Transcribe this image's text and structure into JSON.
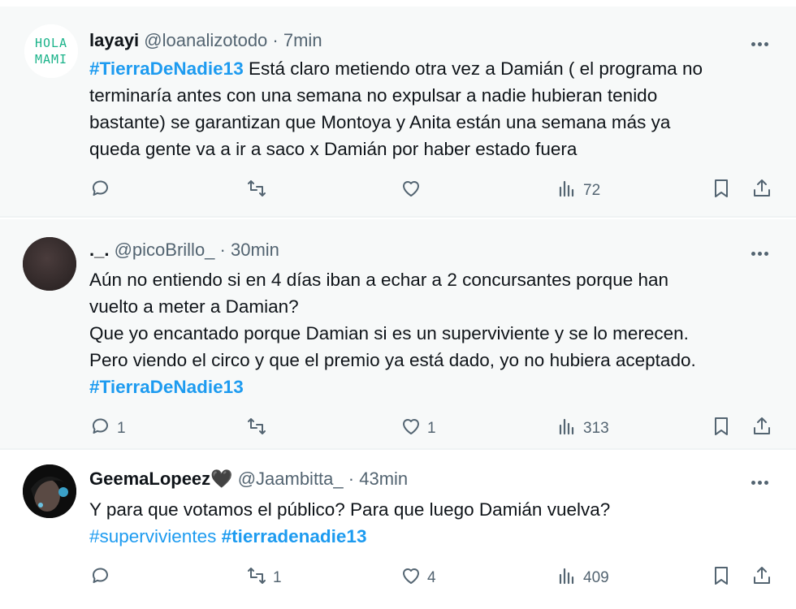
{
  "tweets": [
    {
      "name": "layayi",
      "handle": "@loanalizotodo",
      "separator": "·",
      "time": "7min",
      "avatar_text": "HOLA MAMI",
      "lines": [
        [
          {
            "text": "#TierraDeNadie13",
            "style": "tag-bold"
          },
          {
            "text": " Está claro metiendo otra vez a Damián ( el programa no",
            "style": "text"
          }
        ],
        [
          {
            "text": "terminaría antes con una semana no expulsar a nadie hubieran tenido",
            "style": "text"
          }
        ],
        [
          {
            "text": "bastante) se garantizan que Montoya y Anita están una semana más ya",
            "style": "text"
          }
        ],
        [
          {
            "text": "queda gente va a ir a saco x Damián por haber estado fuera",
            "style": "text"
          }
        ]
      ],
      "counts": {
        "reply": "",
        "retweet": "",
        "like": "",
        "views": "72"
      }
    },
    {
      "name": "._.",
      "handle": "@picoBrillo_",
      "separator": "·",
      "time": "30min",
      "lines": [
        [
          {
            "text": "Aún no entiendo si en 4 días iban a echar a 2 concursantes  porque han",
            "style": "text"
          }
        ],
        [
          {
            "text": "vuelto a meter a Damian?",
            "style": "text"
          }
        ],
        [
          {
            "text": "Que yo encantado porque Damian si es un superviviente y se lo merecen.",
            "style": "text"
          }
        ],
        [
          {
            "text": "Pero viendo el circo y que el premio  ya está  dado, yo no hubiera aceptado.",
            "style": "text"
          }
        ],
        [
          {
            "text": "#TierraDeNadie13",
            "style": "tag-bold"
          }
        ]
      ],
      "counts": {
        "reply": "1",
        "retweet": "",
        "like": "1",
        "views": "313"
      }
    },
    {
      "name": "GeemaLopeez🖤",
      "handle": "@Jaambitta_",
      "separator": "·",
      "time": "43min",
      "lines": [
        [
          {
            "text": "Y para que votamos el público? Para que luego Damián vuelva?",
            "style": "text"
          }
        ],
        [
          {
            "text": "#supervivientes",
            "style": "tag"
          },
          {
            "text": " ",
            "style": "text"
          },
          {
            "text": "#tierradenadie13",
            "style": "tag-bold"
          }
        ]
      ],
      "counts": {
        "reply": "",
        "retweet": "1",
        "like": "4",
        "views": "409"
      }
    }
  ],
  "colors": {
    "text": "#0f1419",
    "secondary": "#536471",
    "link": "#1d9bf0",
    "hover_bg": "#f7f9f9",
    "avatar_green": "#1bb38a"
  },
  "icons": [
    "reply-icon",
    "retweet-icon",
    "like-icon",
    "views-icon",
    "bookmark-icon",
    "share-icon",
    "more-icon"
  ]
}
